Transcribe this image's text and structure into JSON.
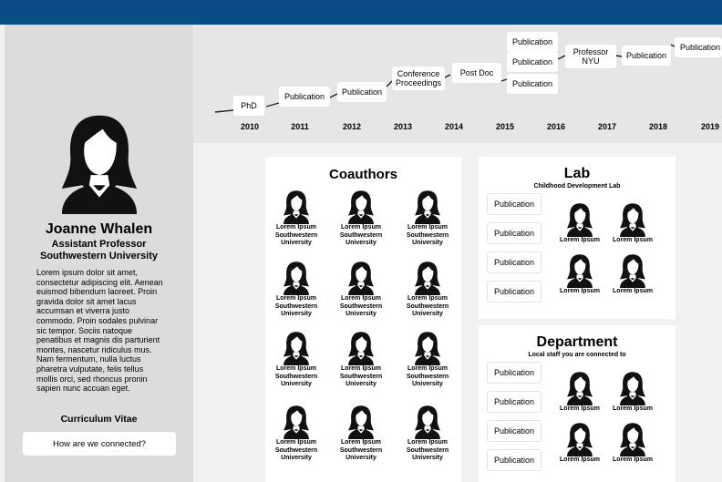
{
  "profile": {
    "name": "Joanne Whalen",
    "title": "Assistant Professor",
    "university": "Southwestern University",
    "bio": "Lorem ipsum dolor sit amet, consectetur adipiscing elit. Aenean euismod bibendum laoreet. Proin gravida dolor sit amet lacus accumsan et viverra justo commodo. Proin sodales pulvinar sic tempor. Sociis natoque penatibus et magnis dis parturient montes, nascetur ridiculus mus. Nam fermentum, nulla luctus pharetra vulputate, felis tellus mollis orci, sed rhoncus pronin sapien nunc accuan eget.",
    "cv_label": "Curriculum Vitae",
    "connect_button": "How are we connected?"
  },
  "timeline": {
    "years": [
      "2010",
      "2011",
      "2012",
      "2013",
      "2014",
      "2015",
      "2016",
      "2017",
      "2018",
      "2019"
    ],
    "events": [
      {
        "label": "PhD"
      },
      {
        "label": "Publication"
      },
      {
        "label": "Publication"
      },
      {
        "label": "Conference Proceedings"
      },
      {
        "label": "Post Doc"
      },
      {
        "label": "Publication"
      },
      {
        "label": "Publication"
      },
      {
        "label": "Publication"
      },
      {
        "label": "Professor NYU"
      },
      {
        "label": "Publication"
      },
      {
        "label": "Publication"
      }
    ]
  },
  "coauthors": {
    "title": "Coauthors",
    "people": [
      {
        "name": "Lorem Ipsum",
        "affiliation": "Southwestern University"
      },
      {
        "name": "Lorem Ipsum",
        "affiliation": "Southwestern University"
      },
      {
        "name": "Lorem Ipsum",
        "affiliation": "Southwestern University"
      },
      {
        "name": "Lorem Ipsum",
        "affiliation": "Southwestern University"
      },
      {
        "name": "Lorem Ipsum",
        "affiliation": "Southwestern University"
      },
      {
        "name": "Lorem Ipsum",
        "affiliation": "Southwestern University"
      },
      {
        "name": "Lorem Ipsum",
        "affiliation": "Southwestern University"
      },
      {
        "name": "Lorem Ipsum",
        "affiliation": "Southwestern University"
      },
      {
        "name": "Lorem Ipsum",
        "affiliation": "Southwestern University"
      },
      {
        "name": "Lorem Ipsum",
        "affiliation": "Southwestern University"
      },
      {
        "name": "Lorem Ipsum",
        "affiliation": "Southwestern University"
      },
      {
        "name": "Lorem Ipsum",
        "affiliation": "Southwestern University"
      }
    ]
  },
  "lab": {
    "title": "Lab",
    "subtitle": "Childhood Development Lab",
    "publications": [
      "Publication",
      "Publication",
      "Publication",
      "Publication"
    ],
    "people": [
      {
        "name": "Lorem Ipsum"
      },
      {
        "name": "Lorem Ipsum"
      },
      {
        "name": "Lorem Ipsum"
      },
      {
        "name": "Lorem Ipsum"
      }
    ]
  },
  "department": {
    "title": "Department",
    "subtitle": "Local staff you are connected to",
    "publications": [
      "Publication",
      "Publication",
      "Publication",
      "Publication"
    ],
    "people": [
      {
        "name": "Lorem Ipsum"
      },
      {
        "name": "Lorem Ipsum"
      },
      {
        "name": "Lorem Ipsum"
      },
      {
        "name": "Lorem Ipsum"
      }
    ]
  },
  "colors": {
    "topbar": "#0b4b86",
    "sidebar": "#dcdcdc",
    "timeline_bg": "#e6e6e6",
    "avatar": "#111111"
  },
  "icons": {
    "avatar": "person-silhouette-icon"
  }
}
